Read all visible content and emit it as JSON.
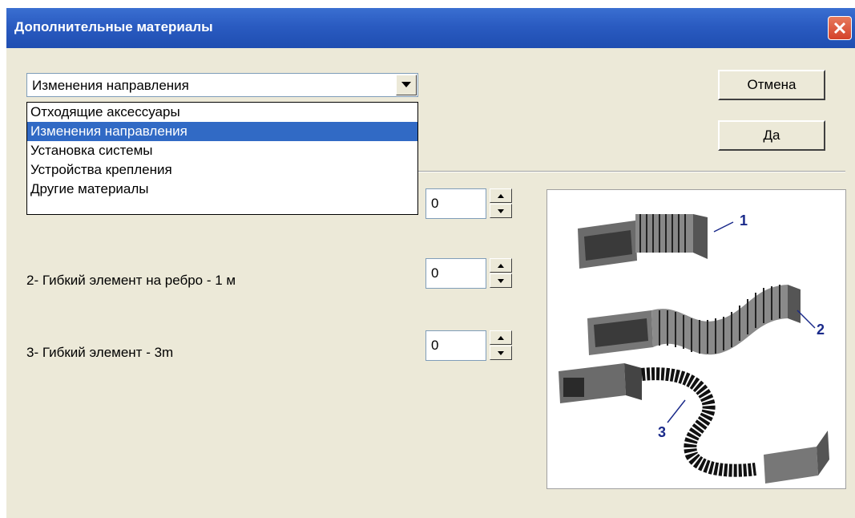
{
  "window": {
    "title": "Дополнительные материалы"
  },
  "combo": {
    "selected": "Изменения направления",
    "options": [
      "Отходящие аксессуары",
      "Изменения направления",
      "Установка системы",
      "Устройства крепления",
      "Другие материалы"
    ],
    "highlighted_index": 1
  },
  "buttons": {
    "cancel": "Отмена",
    "ok": "Да"
  },
  "items": [
    {
      "label": "",
      "value": "0"
    },
    {
      "label": "2-  Гибкий элемент на ребро - 1 м",
      "value": "0"
    },
    {
      "label": "3-  Гибкий элемент - 3m",
      "value": "0"
    }
  ],
  "image": {
    "callouts": [
      "1",
      "2",
      "3"
    ]
  },
  "colors": {
    "titlebar": "#2a5bc1",
    "selection": "#316ac5",
    "dialog_bg": "#ece9d8"
  }
}
